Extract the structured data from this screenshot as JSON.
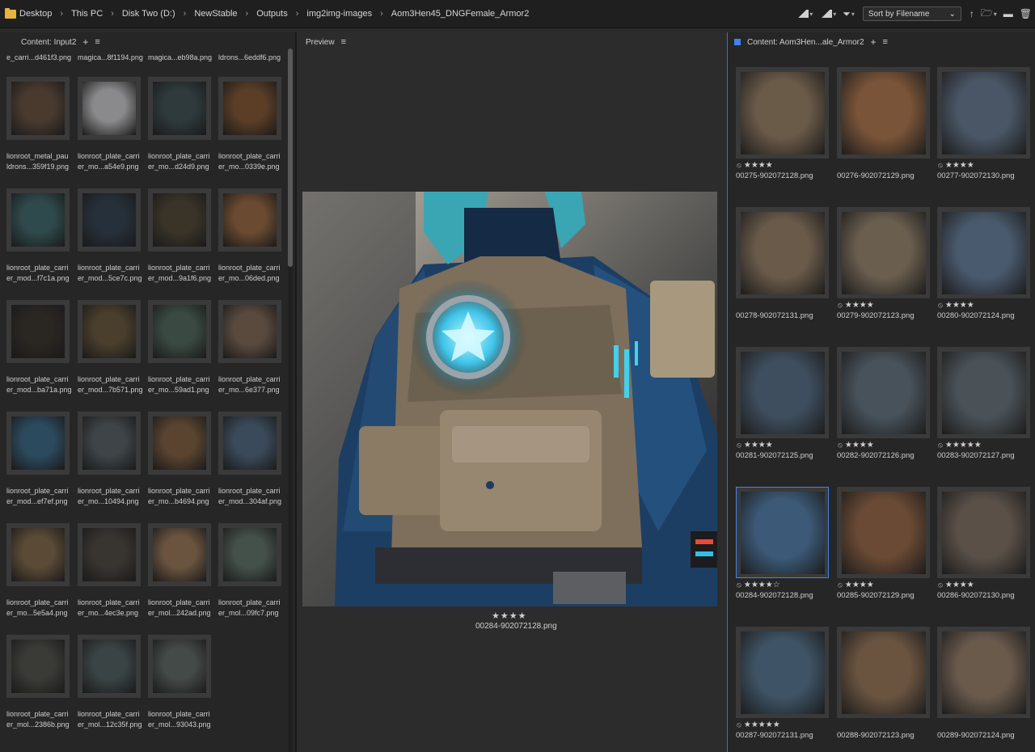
{
  "breadcrumb": [
    "Desktop",
    "This PC",
    "Disk Two (D:)",
    "NewStable",
    "Outputs",
    "img2img-images",
    "Aom3Hen45_DNGFemale_Armor2"
  ],
  "toolbar": {
    "sort_label": "Sort by Filename",
    "icons": [
      "filter-quality-icon",
      "thumbnail-size-icon",
      "filter-icon",
      "sort-select",
      "sort-ascending-icon",
      "open-recent-icon",
      "new-folder-icon",
      "delete-icon"
    ]
  },
  "left_panel": {
    "title": "Content: Input2",
    "top_partial_labels": [
      "e_carri...d461f3.png",
      "magica...8f1194.png",
      "magica...eb98a.png",
      "ldrons...6eddf6.png"
    ],
    "thumbs": [
      {
        "line1": "lionroot_metal_pau",
        "line2": "ldrons...359f19.png",
        "color": "#4a3a2e"
      },
      {
        "line1": "lionroot_plate_carri",
        "line2": "er_mo...a54e9.png",
        "color": "#8a8a8c"
      },
      {
        "line1": "lionroot_plate_carri",
        "line2": "er_mo...d24d9.png",
        "color": "#2e3a3c"
      },
      {
        "line1": "lionroot_plate_carri",
        "line2": "er_mo...0339e.png",
        "color": "#5c3e26"
      },
      {
        "line1": "lionroot_plate_carri",
        "line2": "er_mod...f7c1a.png",
        "color": "#2f4a4c"
      },
      {
        "line1": "lionroot_plate_carri",
        "line2": "er_mod...5ce7c.png",
        "color": "#26303a"
      },
      {
        "line1": "lionroot_plate_carri",
        "line2": "er_mod...9a1f6.png",
        "color": "#3a3428"
      },
      {
        "line1": "lionroot_plate_carri",
        "line2": "er_mo...06ded.png",
        "color": "#6a4a30"
      },
      {
        "line1": "lionroot_plate_carri",
        "line2": "er_mod...ba71a.png",
        "color": "#2a2622"
      },
      {
        "line1": "lionroot_plate_carri",
        "line2": "er_mod...7b571.png",
        "color": "#4a3e2c"
      },
      {
        "line1": "lionroot_plate_carri",
        "line2": "er_mo...59ad1.png",
        "color": "#3a4a42"
      },
      {
        "line1": "lionroot_plate_carri",
        "line2": "er_mo...6e377.png",
        "color": "#5a4a3e"
      },
      {
        "line1": "lionroot_plate_carri",
        "line2": "er_mod...ef7ef.png",
        "color": "#2c4a5e"
      },
      {
        "line1": "lionroot_plate_carri",
        "line2": "er_mo...10494.png",
        "color": "#3e4448"
      },
      {
        "line1": "lionroot_plate_carri",
        "line2": "er_mo...b4694.png",
        "color": "#5a4430"
      },
      {
        "line1": "lionroot_plate_carri",
        "line2": "er_mod...304af.png",
        "color": "#3a4a5a"
      },
      {
        "line1": "lionroot_plate_carri",
        "line2": "er_mo...5e5a4.png",
        "color": "#5a4a36"
      },
      {
        "line1": "lionroot_plate_carri",
        "line2": "er_mo...4ec3e.png",
        "color": "#383430"
      },
      {
        "line1": "lionroot_plate_carri",
        "line2": "er_mol...242ad.png",
        "color": "#6a5440"
      },
      {
        "line1": "lionroot_plate_carri",
        "line2": "er_mol...09fc7.png",
        "color": "#44504a"
      },
      {
        "line1": "lionroot_plate_carri",
        "line2": "er_mol...2386b.png",
        "color": "#3a3a36"
      },
      {
        "line1": "lionroot_plate_carri",
        "line2": "er_mol...12c35f.png",
        "color": "#3a4444"
      },
      {
        "line1": "lionroot_plate_carri",
        "line2": "er_mol...93043.png",
        "color": "#444a48"
      }
    ]
  },
  "preview_panel": {
    "title": "Preview",
    "rating": "★★★★",
    "filename": "00284-902072128.png"
  },
  "right_panel": {
    "title": "Content: Aom3Hen...ale_Armor2",
    "items": [
      {
        "name": "00275-902072128.png",
        "rating": "★★★★",
        "reject": "⃠",
        "selected": false,
        "color": "#6a5a48"
      },
      {
        "name": "00276-902072129.png",
        "rating": "",
        "reject": "",
        "selected": false,
        "color": "#7a5438"
      },
      {
        "name": "00277-902072130.png",
        "rating": "★★★★",
        "reject": "⃠",
        "selected": false,
        "color": "#4a5666"
      },
      {
        "name": "00278-902072131.png",
        "rating": "",
        "reject": "",
        "selected": false,
        "color": "#6a5a4a"
      },
      {
        "name": "00279-902072123.png",
        "rating": "★★★★",
        "reject": "⃠",
        "selected": false,
        "color": "#6a5e4e"
      },
      {
        "name": "00280-902072124.png",
        "rating": "★★★★",
        "reject": "⃠",
        "selected": false,
        "color": "#4a5a6e"
      },
      {
        "name": "00281-902072125.png",
        "rating": "★★★★",
        "reject": "⃠",
        "selected": false,
        "color": "#3e4e5e"
      },
      {
        "name": "00282-902072126.png",
        "rating": "★★★★",
        "reject": "⃠",
        "selected": false,
        "color": "#48525a"
      },
      {
        "name": "00283-902072127.png",
        "rating": "★★★★★",
        "reject": "⃠",
        "selected": false,
        "color": "#4a5258"
      },
      {
        "name": "00284-902072128.png",
        "rating": "★★★★☆",
        "reject": "⃠",
        "selected": true,
        "color": "#3c5a78"
      },
      {
        "name": "00285-902072129.png",
        "rating": "★★★★",
        "reject": "⃠",
        "selected": false,
        "color": "#6a4a34"
      },
      {
        "name": "00286-902072130.png",
        "rating": "★★★★",
        "reject": "⃠",
        "selected": false,
        "color": "#5a5048"
      },
      {
        "name": "00287-902072131.png",
        "rating": "★★★★★",
        "reject": "⃠",
        "selected": false,
        "color": "#3e5466"
      },
      {
        "name": "00288-902072123.png",
        "rating": "",
        "reject": "",
        "selected": false,
        "color": "#6a5440"
      },
      {
        "name": "00289-902072124.png",
        "rating": "",
        "reject": "",
        "selected": false,
        "color": "#6a5a4c"
      }
    ]
  }
}
